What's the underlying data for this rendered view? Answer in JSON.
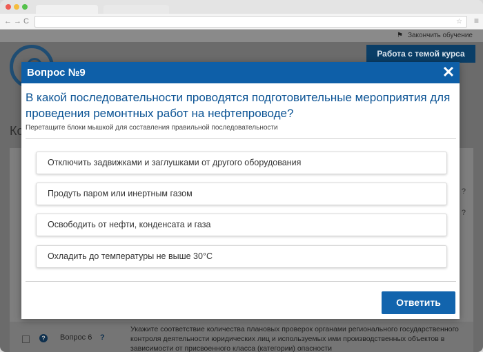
{
  "browser": {
    "nav_back": "←",
    "nav_forward": "→",
    "nav_reload": "C",
    "url": "",
    "star": "☆",
    "menu": "≡"
  },
  "page": {
    "finish_label": "Закончить обучение",
    "work_button": "Работа с темой курса",
    "heading_fragment": "Ко",
    "row_fragments": [
      "?",
      "?"
    ],
    "bottom_row": {
      "label": "Вопрос 6",
      "help": "?",
      "question_mark": "?",
      "text": "Укажите соответствие количества плановых проверок органами регионального государственного контроля деятельности юридических лиц и используемых ими производственных объектов в зависимости от присвоенного класса (категории) опасности"
    }
  },
  "modal": {
    "title": "Вопрос №9",
    "close": "✕",
    "question": "В какой последовательности проводятся подготовительные мероприятия для проведения ремонтных работ на нефтепроводе?",
    "hint": "Перетащите блоки мышкой для составления правильной последовательности",
    "items": [
      "Отключить задвижками и заглушками от другого оборудования",
      "Продуть паром или инертным газом",
      "Освободить от нефти, конденсата и газа",
      "Охладить до температуры не выше 30°С"
    ],
    "submit": "Ответить"
  },
  "colors": {
    "modal_header": "#0e5fa8",
    "question_text": "#0b5394",
    "submit_button": "#1264ad"
  }
}
